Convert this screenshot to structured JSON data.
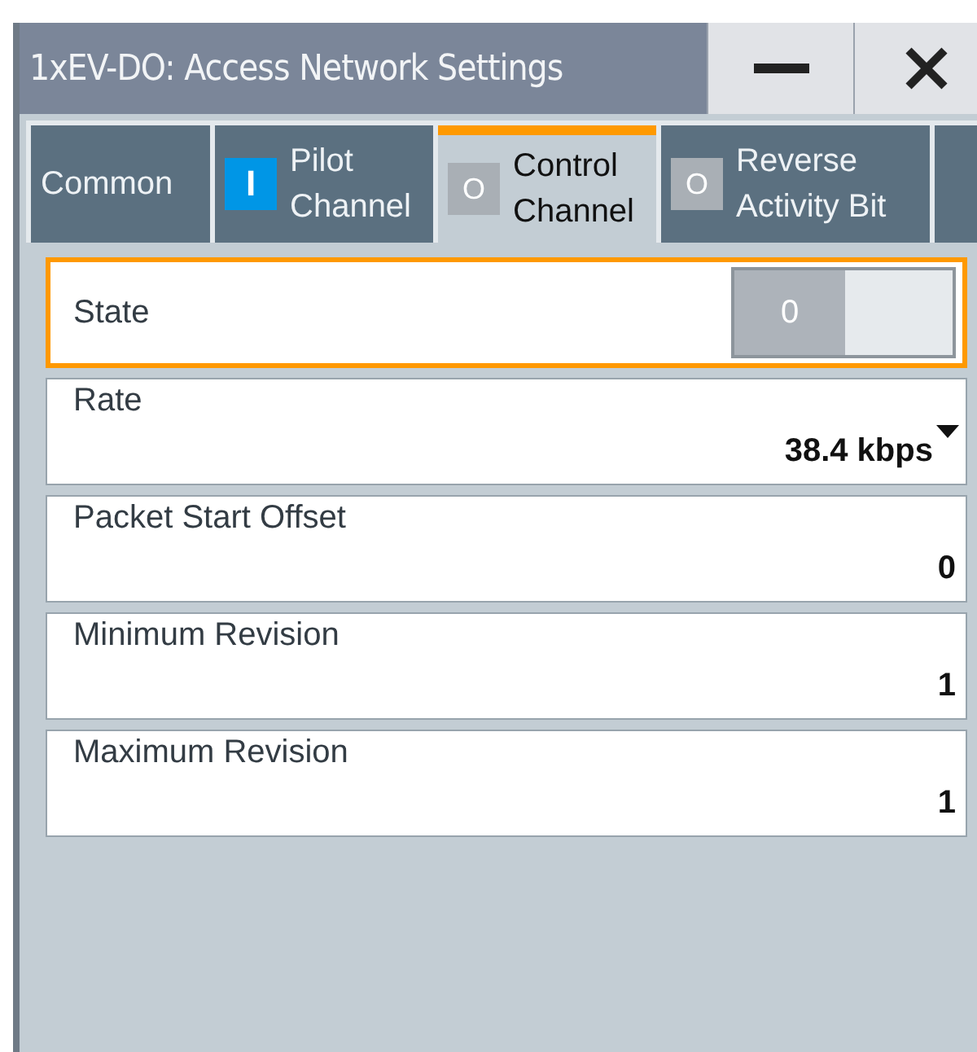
{
  "window": {
    "title": "1xEV-DO: Access Network Settings"
  },
  "tabs": [
    {
      "label": "Common",
      "selected": false
    },
    {
      "label": "Pilot Channel",
      "selected": false,
      "indicator": "I",
      "on": true
    },
    {
      "label": "Control Channel",
      "selected": true,
      "indicator": "O",
      "on": false
    },
    {
      "label": "Reverse Activity Bit",
      "selected": false,
      "indicator": "O",
      "on": false
    }
  ],
  "fields": [
    {
      "kind": "toggle",
      "label": "State",
      "value": "0",
      "on": false,
      "focused": true
    },
    {
      "kind": "dropdown",
      "label": "Rate",
      "value": "38.4 kbps",
      "focused": false
    },
    {
      "kind": "number",
      "label": "Packet Start Offset",
      "value": "0",
      "focused": false
    },
    {
      "kind": "number",
      "label": "Minimum Revision",
      "value": "1",
      "focused": false
    },
    {
      "kind": "number",
      "label": "Maximum Revision",
      "value": "1",
      "focused": false
    }
  ]
}
